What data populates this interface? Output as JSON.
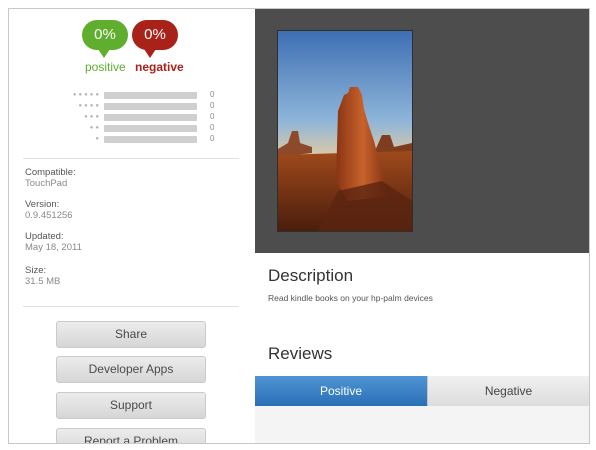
{
  "ratings": {
    "positive_percent": "0%",
    "negative_percent": "0%",
    "positive_label": "positive",
    "negative_label": "negative",
    "colors": {
      "positive": "#5fae2e",
      "negative": "#a8221a"
    },
    "breakdown": [
      {
        "stars": 5,
        "count": "0",
        "fill": 0
      },
      {
        "stars": 4,
        "count": "0",
        "fill": 0
      },
      {
        "stars": 3,
        "count": "0",
        "fill": 0
      },
      {
        "stars": 2,
        "count": "0",
        "fill": 0
      },
      {
        "stars": 1,
        "count": "0",
        "fill": 0
      }
    ]
  },
  "details": {
    "compatible_label": "Compatible:",
    "compatible_value": "TouchPad",
    "version_label": "Version:",
    "version_value": "0.9.451256",
    "updated_label": "Updated:",
    "updated_value": "May 18, 2011",
    "size_label": "Size:",
    "size_value": "31.5 MB"
  },
  "actions": {
    "share": "Share",
    "developer_apps": "Developer Apps",
    "support": "Support",
    "report": "Report a Problem"
  },
  "description": {
    "heading": "Description",
    "text": "Read kindle books on your hp-palm devices"
  },
  "reviews": {
    "heading": "Reviews",
    "tab_positive": "Positive",
    "tab_negative": "Negative"
  }
}
